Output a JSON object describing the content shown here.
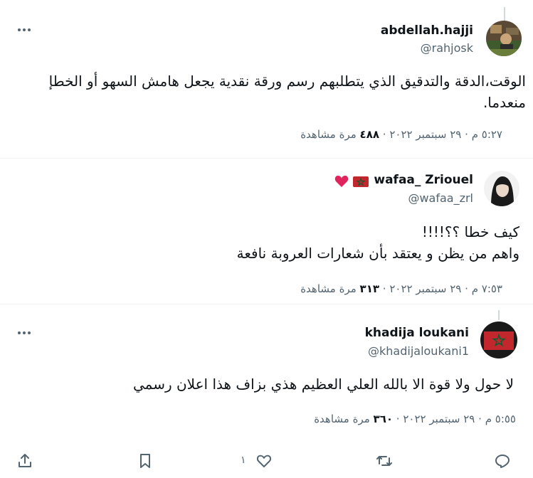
{
  "tweets": [
    {
      "name": "abdellah.hajji",
      "handle": "@rahjosk",
      "lines": [
        "الوقت،الدقة والتدقيق الذي يتطلبهم رسم ورقة نقدية يجعل هامش السهو أو الخطإ",
        "منعدما."
      ],
      "time": "٥:٢٧ م",
      "date": "٢٩ سبتمبر ٢٠٢٢",
      "views": "٤٨٨",
      "views_label": "مرة مشاهدة",
      "sep": "·"
    },
    {
      "name": "wafaa_ Zriouel",
      "handle": "@wafaa_zrl",
      "lines": [
        "كيف خطا ؟؟!!!!",
        "واهم من يظن و يعتقد بأن شعارات العروبة نافعة"
      ],
      "time": "٧:٥٣ م",
      "date": "٢٩ سبتمبر ٢٠٢٢",
      "views": "٣١٣",
      "views_label": "مرة مشاهدة",
      "sep": "·"
    },
    {
      "name": "khadija loukani",
      "handle": "@khadijaloukani1",
      "lines": [
        "لا حول ولا قوة الا بالله العلي العظيم هذي بزاف هذا اعلان رسمي"
      ],
      "time": "٥:٥٥ م",
      "date": "٢٩ سبتمبر ٢٠٢٢",
      "views": "٣٦٠",
      "views_label": "مرة مشاهدة",
      "sep": "·"
    }
  ],
  "actions": {
    "like_count": "١",
    "icons": [
      "share-icon",
      "bookmark-icon",
      "like-icon",
      "retweet-icon",
      "reply-icon"
    ]
  },
  "colors": {
    "text": "#0f1419",
    "secondary": "#536471",
    "thread_line": "#cfd9de",
    "moroccan_red": "#c1272d",
    "moroccan_green": "#006233",
    "heart_red": "#e0245e"
  }
}
